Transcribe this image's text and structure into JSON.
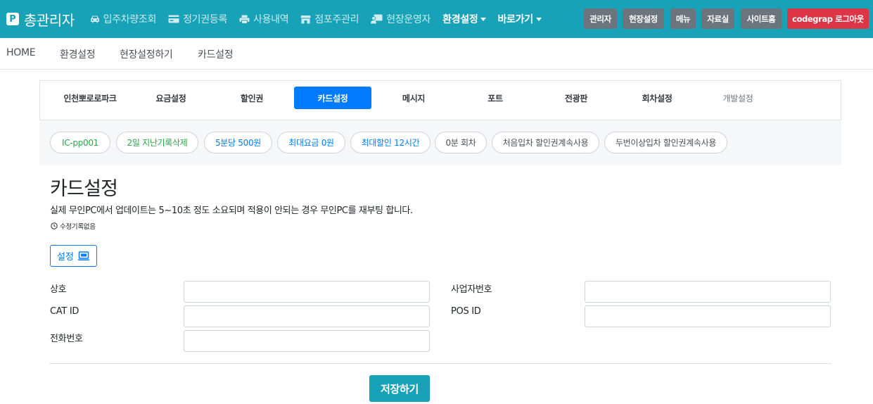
{
  "app": {
    "title": "총관리자",
    "logo_letter": "P"
  },
  "nav": {
    "items": [
      {
        "label": "입주차량조회",
        "icon": "car-icon"
      },
      {
        "label": "정기권등록",
        "icon": "card-icon"
      },
      {
        "label": "사용내역",
        "icon": "print-icon"
      },
      {
        "label": "점포주관리",
        "icon": "store-icon"
      },
      {
        "label": "현장운영자",
        "icon": "operator-icon"
      }
    ],
    "env_menu": "환경설정",
    "shortcut_menu": "바로가기"
  },
  "top_buttons": {
    "admin": "관리자",
    "site_setting": "현장설정",
    "menu": "메뉴",
    "resources": "자료실",
    "site_home": "사이트홈",
    "logout": "codegrap 로그아웃"
  },
  "breadcrumb": [
    "HOME",
    "환경설정",
    "현장설정하기",
    "카드설정"
  ],
  "tabs": [
    {
      "label": "인천뽀로로파크"
    },
    {
      "label": "요금설정"
    },
    {
      "label": "할인권"
    },
    {
      "label": "카드설정",
      "active": true
    },
    {
      "label": "메시지"
    },
    {
      "label": "포트"
    },
    {
      "label": "전광판"
    },
    {
      "label": "회차설정"
    },
    {
      "label": "개발설정",
      "muted": true
    }
  ],
  "chips": [
    {
      "label": "IC-pp001",
      "color": "#28a745"
    },
    {
      "label": "2일 지난기록삭제",
      "color": "#28a745"
    },
    {
      "label": "5분당 500원",
      "color": "#007bff"
    },
    {
      "label": "최대요금 0원",
      "color": "#007bff"
    },
    {
      "label": "최대할인 12시간",
      "color": "#007bff"
    },
    {
      "label": "0분 회차",
      "color": "#495057"
    },
    {
      "label": "처음입차 할인권계속사용",
      "color": "#495057"
    },
    {
      "label": "두번이상입차 할인권계속사용",
      "color": "#495057"
    }
  ],
  "page": {
    "title": "카드설정",
    "description": "실제 무인PC에서 업데이트는 5~10초 정도 소요되며 적용이 안되는 경우 무인PC를 재부팅 합니다.",
    "history": "수정기록없음",
    "setting_button": "설정"
  },
  "form": {
    "company_label": "상호",
    "company_value": "",
    "business_no_label": "사업자번호",
    "business_no_value": "",
    "cat_id_label": "CAT ID",
    "cat_id_value": "",
    "pos_id_label": "POS ID",
    "pos_id_value": "",
    "phone_label": "전화번호",
    "phone_value": "",
    "save_button": "저장하기"
  },
  "colors": {
    "primary_teal": "#17a2b8",
    "primary_blue": "#007bff",
    "logout_red": "#dc3545",
    "gray_button": "#6c757d",
    "green_text": "#28a745"
  }
}
